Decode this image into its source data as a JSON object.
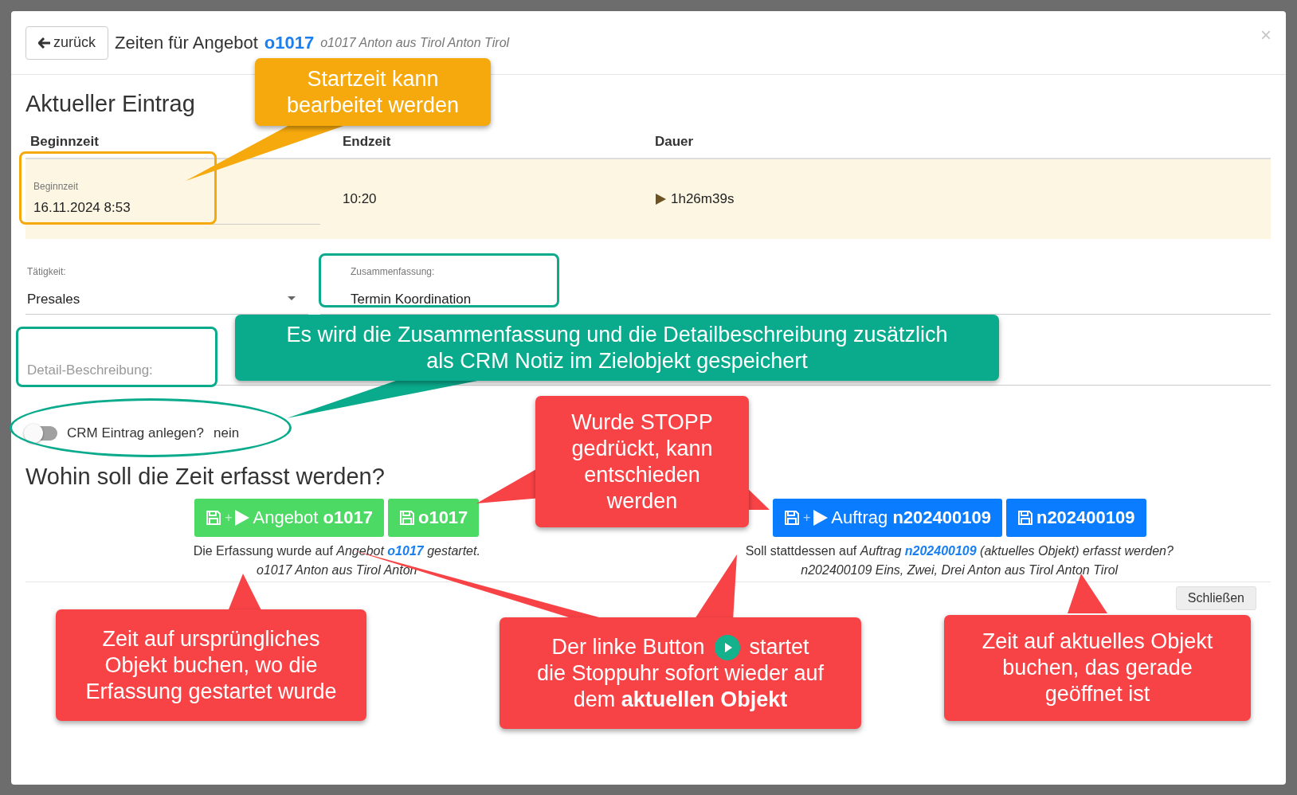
{
  "header": {
    "back_button": "zurück",
    "title": "Zeiten für Angebot",
    "title_link": "o1017",
    "subtitle": "o1017 Anton aus Tirol Anton Tirol",
    "close": "×"
  },
  "current_entry": {
    "heading": "Aktueller Eintrag",
    "columns": [
      "Beginnzeit",
      "Endzeit",
      "Dauer"
    ],
    "start_field": {
      "label": "Beginnzeit",
      "value": "16.11.2024 8:53"
    },
    "end": "10:20",
    "duration": "1h26m39s",
    "running": true
  },
  "form": {
    "activity": {
      "label": "Tätigkeit:",
      "value": "Presales"
    },
    "summary": {
      "label": "Zusammenfassung:",
      "value": "Termin Koordination"
    },
    "detail": {
      "placeholder": "Detail-Beschreibung:"
    },
    "crm_toggle": {
      "label": "CRM Eintrag anlegen?",
      "state_text": "nein",
      "on": false
    }
  },
  "targets": {
    "heading": "Wohin soll die Zeit erfasst werden?",
    "groups": [
      {
        "buttons": [
          {
            "kind": "start_and_save",
            "joiner": "+",
            "type": "Angebot",
            "id": "o1017"
          },
          {
            "kind": "save",
            "id": "o1017"
          }
        ],
        "caption": {
          "prefix": "Die Erfassung wurde auf",
          "object_type": "Angebot",
          "link": "o1017",
          "suffix": "gestartet."
        },
        "detail_line": "o1017 Anton aus Tirol Anton"
      },
      {
        "buttons": [
          {
            "kind": "start_and_save",
            "joiner": "+",
            "type": "Auftrag",
            "id": "n202400109"
          },
          {
            "kind": "save",
            "id": "n202400109"
          }
        ],
        "caption": {
          "prefix": "Soll stattdessen auf",
          "object_type": "Auftrag",
          "link": "n202400109",
          "suffix": "(aktuelles Objekt) erfasst werden?"
        },
        "detail_line": "n202400109 Eins, Zwei, Drei Anton aus Tirol Anton Tirol"
      }
    ]
  },
  "footer": {
    "close_button": "Schließen"
  },
  "callouts": [
    {
      "color": "#f6a90d",
      "text": "Startzeit kann bearbeitet werden"
    },
    {
      "color": "#0aaa8c",
      "text": "Es wird die Zusammenfassung und die Detailbeschreibung zusätzlich als CRM Notiz im Zielobjekt gespeichert"
    },
    {
      "color": "#f84346",
      "text": "Wurde STOPP gedrückt, kann entschieden werden"
    },
    {
      "color": "#f84346",
      "text": "Zeit auf ursprüngliches Objekt buchen, wo die Erfassung gestartet wurde"
    },
    {
      "color": "#f84346",
      "text": "Der linke Button",
      "text_after": "startet",
      "text_more": "die Stoppuhr sofort wieder auf dem **aktuellen Objekt**"
    },
    {
      "color": "#f84346",
      "text": "Zeit auf aktuelles Objekt buchen, das gerade geöffnet ist"
    }
  ]
}
